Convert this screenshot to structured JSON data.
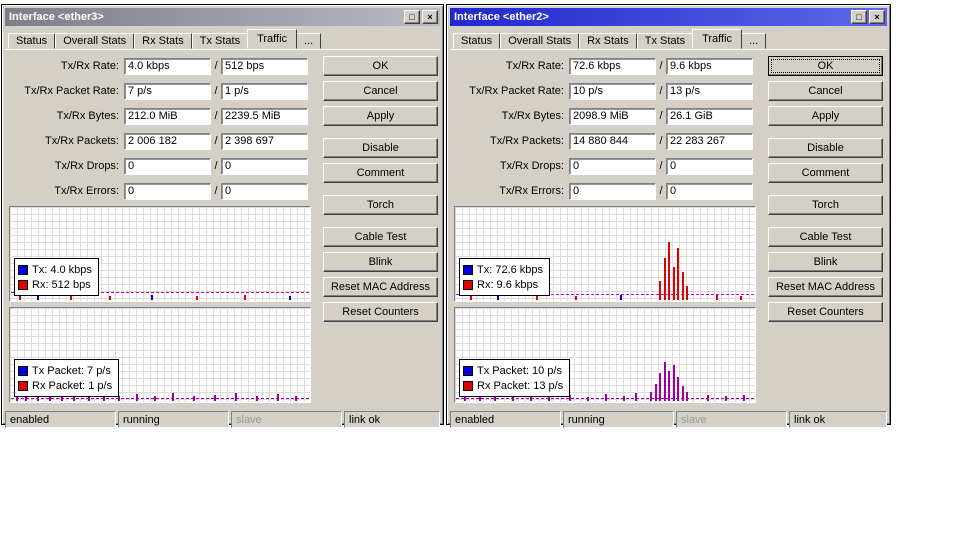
{
  "windows": [
    {
      "title": "Interface <ether3>",
      "state": "inactive",
      "titlebar_buttons": [
        {
          "name": "maximize-button",
          "glyph": "□"
        },
        {
          "name": "close-button",
          "glyph": "×"
        }
      ],
      "tabs": [
        {
          "name": "tab-status",
          "label": "Status"
        },
        {
          "name": "tab-overall-stats",
          "label": "Overall Stats"
        },
        {
          "name": "tab-rx-stats",
          "label": "Rx Stats"
        },
        {
          "name": "tab-tx-stats",
          "label": "Tx Stats"
        },
        {
          "name": "tab-traffic",
          "label": "Traffic",
          "active": true
        },
        {
          "name": "tab-more",
          "label": "..."
        }
      ],
      "value_separator": "/",
      "fields": [
        {
          "name": "field-tx-rx-rate",
          "label": "Tx/Rx Rate:",
          "v1": "4.0 kbps",
          "v2": "512 bps"
        },
        {
          "name": "field-tx-rx-packet-rate",
          "label": "Tx/Rx Packet Rate:",
          "v1": "7 p/s",
          "v2": "1 p/s"
        },
        {
          "name": "field-tx-rx-bytes",
          "label": "Tx/Rx Bytes:",
          "v1": "212.0 MiB",
          "v2": "2239.5 MiB"
        },
        {
          "name": "field-tx-rx-packets",
          "label": "Tx/Rx Packets:",
          "v1": "2 006 182",
          "v2": "2 398 697"
        },
        {
          "name": "field-tx-rx-drops",
          "label": "Tx/Rx Drops:",
          "v1": "0",
          "v2": "0"
        },
        {
          "name": "field-tx-rx-errors",
          "label": "Tx/Rx Errors:",
          "v1": "0",
          "v2": "0"
        }
      ],
      "buttons": [
        {
          "name": "ok-button",
          "label": "OK"
        },
        {
          "name": "cancel-button",
          "label": "Cancel"
        },
        {
          "name": "apply-button",
          "label": "Apply"
        },
        {
          "name": "disable-button",
          "label": "Disable",
          "gap": true
        },
        {
          "name": "comment-button",
          "label": "Comment"
        },
        {
          "name": "torch-button",
          "label": "Torch",
          "gap": true
        },
        {
          "name": "cable-test-button",
          "label": "Cable Test",
          "gap": true
        },
        {
          "name": "blink-button",
          "label": "Blink"
        },
        {
          "name": "reset-mac-address-button",
          "label": "Reset MAC Address"
        },
        {
          "name": "reset-counters-button",
          "label": "Reset Counters"
        }
      ],
      "charts": [
        {
          "name": "traffic-rate-chart",
          "legend": [
            {
              "name": "legend-tx",
              "color": "#0000e0",
              "label": "Tx:  4.0 kbps"
            },
            {
              "name": "legend-rx",
              "color": "#e00000",
              "label": "Rx:  512 bps"
            }
          ],
          "baseline": {
            "color": "#cc00cc",
            "bottom_pct": 8
          },
          "spikes": [
            [
              0.03,
              0.05,
              "#e00000"
            ],
            [
              0.09,
              0.04,
              "#0000d0"
            ],
            [
              0.2,
              0.05,
              "#e00000"
            ],
            [
              0.33,
              0.04,
              "#e00000"
            ],
            [
              0.47,
              0.05,
              "#0000d0"
            ],
            [
              0.62,
              0.04,
              "#e00000"
            ],
            [
              0.78,
              0.05,
              "#e00000"
            ],
            [
              0.93,
              0.04,
              "#0000d0"
            ]
          ]
        },
        {
          "name": "traffic-packet-chart",
          "legend": [
            {
              "name": "legend-tx-packet",
              "color": "#0000e0",
              "label": "Tx Packet:  7 p/s"
            },
            {
              "name": "legend-rx-packet",
              "color": "#e00000",
              "label": "Rx Packet:  1 p/s"
            }
          ],
          "baseline": {
            "color": "#990099",
            "bottom_pct": 3
          },
          "spikes": [
            [
              0.02,
              0.1,
              "#990099"
            ],
            [
              0.05,
              0.06,
              "#990099"
            ],
            [
              0.09,
              0.12,
              "#990099"
            ],
            [
              0.13,
              0.05,
              "#990099"
            ],
            [
              0.17,
              0.08,
              "#990099"
            ],
            [
              0.21,
              0.05,
              "#990099"
            ],
            [
              0.26,
              0.09,
              "#990099"
            ],
            [
              0.31,
              0.06,
              "#990099"
            ],
            [
              0.36,
              0.05,
              "#990099"
            ],
            [
              0.42,
              0.07,
              "#990099"
            ],
            [
              0.48,
              0.05,
              "#990099"
            ],
            [
              0.54,
              0.08,
              "#990099"
            ],
            [
              0.61,
              0.05,
              "#990099"
            ],
            [
              0.68,
              0.06,
              "#990099"
            ],
            [
              0.75,
              0.09,
              "#990099"
            ],
            [
              0.82,
              0.05,
              "#990099"
            ],
            [
              0.89,
              0.07,
              "#990099"
            ],
            [
              0.95,
              0.05,
              "#990099"
            ]
          ]
        }
      ],
      "statusbar": [
        {
          "name": "status-enabled",
          "label": "enabled"
        },
        {
          "name": "status-running",
          "label": "running"
        },
        {
          "name": "status-slave",
          "label": "slave",
          "muted": true
        },
        {
          "name": "status-link",
          "label": "link ok"
        }
      ]
    },
    {
      "title": "Interface <ether2>",
      "state": "active",
      "titlebar_buttons": [
        {
          "name": "maximize-button",
          "glyph": "□"
        },
        {
          "name": "close-button",
          "glyph": "×"
        }
      ],
      "tabs": [
        {
          "name": "tab-status",
          "label": "Status"
        },
        {
          "name": "tab-overall-stats",
          "label": "Overall Stats"
        },
        {
          "name": "tab-rx-stats",
          "label": "Rx Stats"
        },
        {
          "name": "tab-tx-stats",
          "label": "Tx Stats"
        },
        {
          "name": "tab-traffic",
          "label": "Traffic",
          "active": true
        },
        {
          "name": "tab-more",
          "label": "..."
        }
      ],
      "value_separator": "/",
      "fields": [
        {
          "name": "field-tx-rx-rate",
          "label": "Tx/Rx Rate:",
          "v1": "72.6 kbps",
          "v2": "9.6 kbps"
        },
        {
          "name": "field-tx-rx-packet-rate",
          "label": "Tx/Rx Packet Rate:",
          "v1": "10 p/s",
          "v2": "13 p/s"
        },
        {
          "name": "field-tx-rx-bytes",
          "label": "Tx/Rx Bytes:",
          "v1": "2098.9 MiB",
          "v2": "26.1 GiB"
        },
        {
          "name": "field-tx-rx-packets",
          "label": "Tx/Rx Packets:",
          "v1": "14 880 844",
          "v2": "22 283 267"
        },
        {
          "name": "field-tx-rx-drops",
          "label": "Tx/Rx Drops:",
          "v1": "0",
          "v2": "0"
        },
        {
          "name": "field-tx-rx-errors",
          "label": "Tx/Rx Errors:",
          "v1": "0",
          "v2": "0"
        }
      ],
      "buttons": [
        {
          "name": "ok-button",
          "label": "OK",
          "default": true
        },
        {
          "name": "cancel-button",
          "label": "Cancel"
        },
        {
          "name": "apply-button",
          "label": "Apply"
        },
        {
          "name": "disable-button",
          "label": "Disable",
          "gap": true
        },
        {
          "name": "comment-button",
          "label": "Comment"
        },
        {
          "name": "torch-button",
          "label": "Torch",
          "gap": true
        },
        {
          "name": "cable-test-button",
          "label": "Cable Test",
          "gap": true
        },
        {
          "name": "blink-button",
          "label": "Blink"
        },
        {
          "name": "reset-mac-address-button",
          "label": "Reset MAC Address"
        },
        {
          "name": "reset-counters-button",
          "label": "Reset Counters"
        }
      ],
      "charts": [
        {
          "name": "traffic-rate-chart",
          "legend": [
            {
              "name": "legend-tx",
              "color": "#0000e0",
              "label": "Tx:  72.6 kbps"
            },
            {
              "name": "legend-rx",
              "color": "#e00000",
              "label": "Rx:  9.6 kbps"
            }
          ],
          "baseline": {
            "color": "#cc00cc",
            "bottom_pct": 6
          },
          "spikes": [
            [
              0.05,
              0.05,
              "#e00000"
            ],
            [
              0.14,
              0.04,
              "#0000d0"
            ],
            [
              0.27,
              0.05,
              "#e00000"
            ],
            [
              0.4,
              0.04,
              "#e00000"
            ],
            [
              0.55,
              0.05,
              "#0000d0"
            ],
            [
              0.68,
              0.2,
              "#e00000"
            ],
            [
              0.695,
              0.45,
              "#e00000"
            ],
            [
              0.71,
              0.62,
              "#e00000"
            ],
            [
              0.725,
              0.35,
              "#e00000"
            ],
            [
              0.74,
              0.55,
              "#e00000"
            ],
            [
              0.755,
              0.3,
              "#e00000"
            ],
            [
              0.77,
              0.15,
              "#e00000"
            ],
            [
              0.87,
              0.05,
              "#e00000"
            ],
            [
              0.95,
              0.04,
              "#e00000"
            ]
          ]
        },
        {
          "name": "traffic-packet-chart",
          "legend": [
            {
              "name": "legend-tx-packet",
              "color": "#0000e0",
              "label": "Tx Packet:  10 p/s"
            },
            {
              "name": "legend-rx-packet",
              "color": "#e00000",
              "label": "Rx Packet:  13 p/s"
            }
          ],
          "baseline": {
            "color": "#990099",
            "bottom_pct": 3
          },
          "spikes": [
            [
              0.03,
              0.06,
              "#a000a0"
            ],
            [
              0.08,
              0.04,
              "#a000a0"
            ],
            [
              0.13,
              0.07,
              "#a000a0"
            ],
            [
              0.19,
              0.05,
              "#a000a0"
            ],
            [
              0.25,
              0.08,
              "#a000a0"
            ],
            [
              0.31,
              0.05,
              "#a000a0"
            ],
            [
              0.38,
              0.06,
              "#a000a0"
            ],
            [
              0.44,
              0.04,
              "#a000a0"
            ],
            [
              0.5,
              0.07,
              "#a000a0"
            ],
            [
              0.56,
              0.05,
              "#a000a0"
            ],
            [
              0.6,
              0.08,
              "#a000a0"
            ],
            [
              0.65,
              0.1,
              "#a000a0"
            ],
            [
              0.665,
              0.18,
              "#a000a0"
            ],
            [
              0.68,
              0.3,
              "#a000a0"
            ],
            [
              0.695,
              0.42,
              "#a000a0"
            ],
            [
              0.71,
              0.32,
              "#a000a0"
            ],
            [
              0.725,
              0.38,
              "#a000a0"
            ],
            [
              0.74,
              0.26,
              "#a000a0"
            ],
            [
              0.755,
              0.16,
              "#a000a0"
            ],
            [
              0.77,
              0.1,
              "#a000a0"
            ],
            [
              0.84,
              0.06,
              "#a000a0"
            ],
            [
              0.9,
              0.05,
              "#a000a0"
            ],
            [
              0.96,
              0.06,
              "#a000a0"
            ]
          ]
        }
      ],
      "statusbar": [
        {
          "name": "status-enabled",
          "label": "enabled"
        },
        {
          "name": "status-running",
          "label": "running"
        },
        {
          "name": "status-slave",
          "label": "slave",
          "muted": true
        },
        {
          "name": "status-link",
          "label": "link ok"
        }
      ]
    }
  ]
}
